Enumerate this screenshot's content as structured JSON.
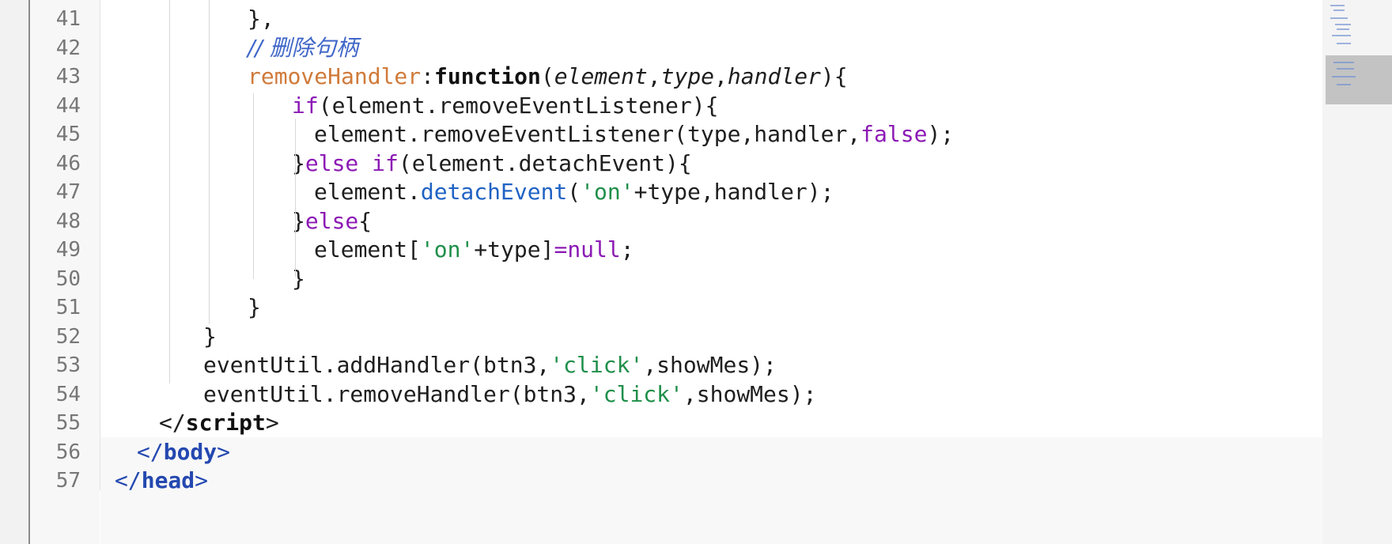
{
  "editor": {
    "line_numbers": [
      "41",
      "42",
      "43",
      "44",
      "45",
      "46",
      "47",
      "48",
      "49",
      "50",
      "51",
      "52",
      "53",
      "54",
      "55",
      "56",
      "57"
    ],
    "lines": [
      {
        "indent": 6,
        "tokens": [
          {
            "t": "},"
          }
        ]
      },
      {
        "indent": 6,
        "tokens": [
          {
            "t": "// 删除句柄",
            "c": "k-comment"
          }
        ]
      },
      {
        "indent": 6,
        "tokens": [
          {
            "t": "removeHandler",
            "c": "k-orange"
          },
          {
            "t": ":"
          },
          {
            "t": "function",
            "c": "k-bold"
          },
          {
            "t": "("
          },
          {
            "t": "element",
            "c": "k-italic"
          },
          {
            "t": ","
          },
          {
            "t": "type",
            "c": "k-italic"
          },
          {
            "t": ","
          },
          {
            "t": "handler",
            "c": "k-italic"
          },
          {
            "t": "){"
          }
        ]
      },
      {
        "indent": 8,
        "tokens": [
          {
            "t": "if",
            "c": "k-purple"
          },
          {
            "t": "(element.removeEventListener){"
          }
        ]
      },
      {
        "indent": 9,
        "tokens": [
          {
            "t": "element.removeEventListener(type,handler,"
          },
          {
            "t": "false",
            "c": "k-purple"
          },
          {
            "t": ");"
          }
        ]
      },
      {
        "indent": 8,
        "tokens": [
          {
            "t": "}"
          },
          {
            "t": "else if",
            "c": "k-purple"
          },
          {
            "t": "(element.detachEvent){"
          }
        ]
      },
      {
        "indent": 9,
        "tokens": [
          {
            "t": "element."
          },
          {
            "t": "detachEvent",
            "c": "k-blue"
          },
          {
            "t": "("
          },
          {
            "t": "'on'",
            "c": "k-str"
          },
          {
            "t": "+type,handler);"
          }
        ]
      },
      {
        "indent": 8,
        "tokens": [
          {
            "t": "}"
          },
          {
            "t": "else",
            "c": "k-purple"
          },
          {
            "t": "{"
          }
        ]
      },
      {
        "indent": 9,
        "tokens": [
          {
            "t": "element["
          },
          {
            "t": "'on'",
            "c": "k-str"
          },
          {
            "t": "+type]"
          },
          {
            "t": "=",
            "c": "k-purple"
          },
          {
            "t": "null",
            "c": "k-purple"
          },
          {
            "t": ";"
          }
        ]
      },
      {
        "indent": 8,
        "tokens": [
          {
            "t": "}"
          }
        ]
      },
      {
        "indent": 6,
        "tokens": [
          {
            "t": "}"
          }
        ]
      },
      {
        "indent": 4,
        "tokens": [
          {
            "t": "}"
          }
        ]
      },
      {
        "indent": 4,
        "tokens": [
          {
            "t": "eventUtil.addHandler(btn3,"
          },
          {
            "t": "'click'",
            "c": "k-str"
          },
          {
            "t": ",showMes);"
          }
        ]
      },
      {
        "indent": 4,
        "tokens": [
          {
            "t": "eventUtil.removeHandler(btn3,"
          },
          {
            "t": "'click'",
            "c": "k-str"
          },
          {
            "t": ",showMes);"
          }
        ]
      },
      {
        "indent": 2,
        "tokens": [
          {
            "t": "</"
          },
          {
            "t": "script",
            "c": "k-bold"
          },
          {
            "t": ">"
          }
        ]
      },
      {
        "indent": 1,
        "tokens": [
          {
            "t": "</",
            "c": "k-tag"
          },
          {
            "t": "body",
            "c": "k-tag k-bold"
          },
          {
            "t": ">",
            "c": "k-tag"
          }
        ]
      },
      {
        "indent": 0,
        "tokens": [
          {
            "t": "</",
            "c": "k-tag"
          },
          {
            "t": "head",
            "c": "k-tag k-bold"
          },
          {
            "t": ">",
            "c": "k-tag"
          }
        ]
      }
    ]
  }
}
